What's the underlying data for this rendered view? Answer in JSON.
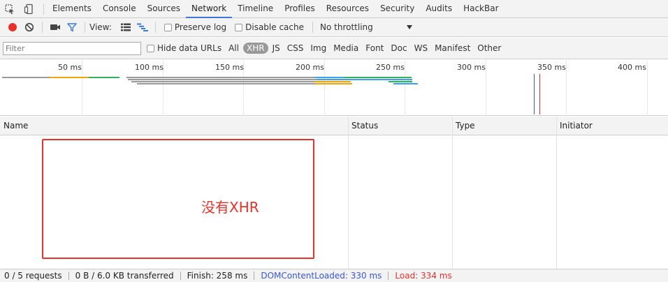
{
  "tabs": [
    {
      "label": "Elements"
    },
    {
      "label": "Console"
    },
    {
      "label": "Sources"
    },
    {
      "label": "Network"
    },
    {
      "label": "Timeline"
    },
    {
      "label": "Profiles"
    },
    {
      "label": "Resources"
    },
    {
      "label": "Security"
    },
    {
      "label": "Audits"
    },
    {
      "label": "HackBar"
    }
  ],
  "active_tab": "Network",
  "toolbar": {
    "view_label": "View:",
    "preserve_log": "Preserve log",
    "disable_cache": "Disable cache",
    "throttling": "No throttling"
  },
  "filter": {
    "placeholder": "Filter",
    "hide_data_urls": "Hide data URLs",
    "types": [
      "All",
      "XHR",
      "JS",
      "CSS",
      "Img",
      "Media",
      "Font",
      "Doc",
      "WS",
      "Manifest",
      "Other"
    ],
    "active_type": "XHR"
  },
  "overview": {
    "ticks": [
      "50 ms",
      "100 ms",
      "150 ms",
      "200 ms",
      "250 ms",
      "300 ms",
      "350 ms",
      "400 ms"
    ],
    "dom_content_loaded_ms": 330,
    "load_ms": 334,
    "colors": {
      "dcl": "#3a57d9",
      "load": "#e8312b",
      "orange": "#f0a30a",
      "green": "#32b05a",
      "blue": "#3aa0e8",
      "gray": "#999999"
    }
  },
  "table": {
    "columns": [
      "Name",
      "Status",
      "Type",
      "Initiator"
    ]
  },
  "annotation": "没有XHR",
  "status": {
    "requests": "0 / 5 requests",
    "transferred": "0 B / 6.0 KB transferred",
    "finish": "Finish: 258 ms",
    "dcl": "DOMContentLoaded: 330 ms",
    "load": "Load: 334 ms"
  }
}
